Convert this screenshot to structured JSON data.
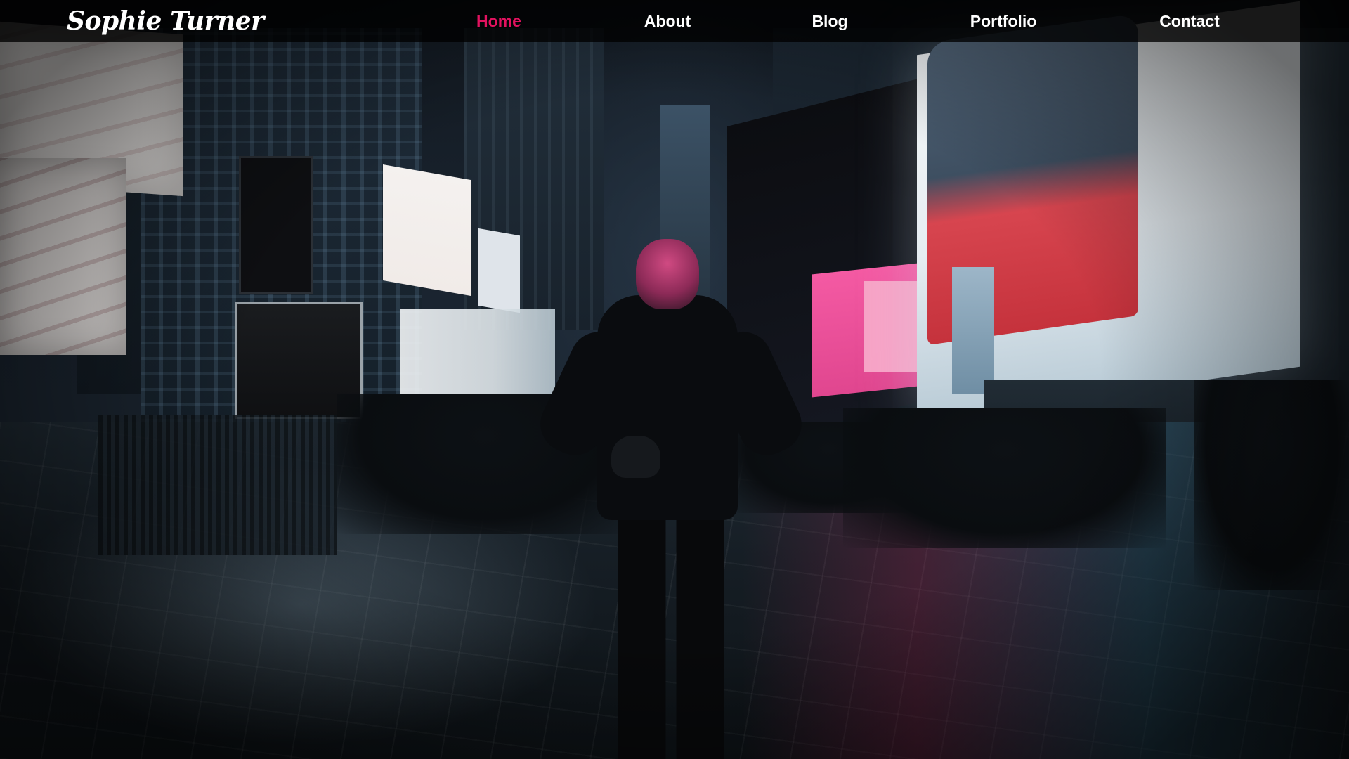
{
  "brand": {
    "logo_text": "Sophie Turner"
  },
  "nav": {
    "items": [
      {
        "label": "Home",
        "active": true
      },
      {
        "label": "About",
        "active": false
      },
      {
        "label": "Blog",
        "active": false
      },
      {
        "label": "Portfolio",
        "active": false
      },
      {
        "label": "Contact",
        "active": false
      }
    ],
    "active_color": "#e2125f",
    "text_color": "#ffffff",
    "bar_color": "#000000"
  },
  "hero": {
    "image": "night-city-street-woman-silhouette"
  }
}
